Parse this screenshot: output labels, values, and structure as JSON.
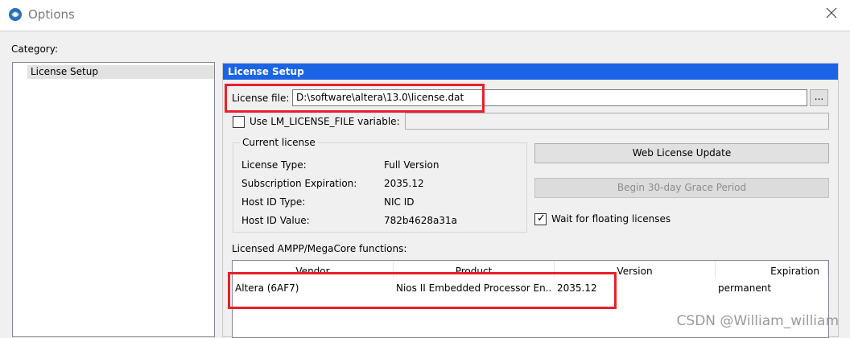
{
  "window": {
    "title": "Options"
  },
  "category": {
    "label": "Category:",
    "items": [
      {
        "label": "License Setup",
        "selected": true
      }
    ]
  },
  "panel": {
    "header": "License Setup",
    "license_file_label": "License file:",
    "license_file_value": "D:\\software\\altera\\13.0\\license.dat",
    "browse_label": "...",
    "use_env_label": "Use LM_LICENSE_FILE variable:",
    "use_env_checked": false,
    "env_value": "",
    "current_license": {
      "title": "Current license",
      "rows": [
        {
          "label": "License Type:",
          "value": "Full Version"
        },
        {
          "label": "Subscription Expiration:",
          "value": "2035.12"
        },
        {
          "label": "Host ID Type:",
          "value": "NIC ID"
        },
        {
          "label": "Host ID Value:",
          "value": "782b4628a31a"
        }
      ]
    },
    "web_update_label": "Web License Update",
    "grace_period_label": "Begin 30-day Grace Period",
    "wait_floating_label": "Wait for floating licenses",
    "wait_floating_checked": true,
    "functions_label": "Licensed AMPP/MegaCore functions:",
    "table": {
      "columns": [
        "Vendor",
        "Product",
        "Version",
        "Expiration"
      ],
      "rows": [
        [
          "Altera (6AF7)",
          "Nios II Embedded Processor En...",
          "2035.12",
          "permanent"
        ]
      ]
    }
  },
  "watermark": "CSDN @William_william",
  "colors": {
    "header_bg": "#1c64e6",
    "highlight": "#e8202a"
  }
}
